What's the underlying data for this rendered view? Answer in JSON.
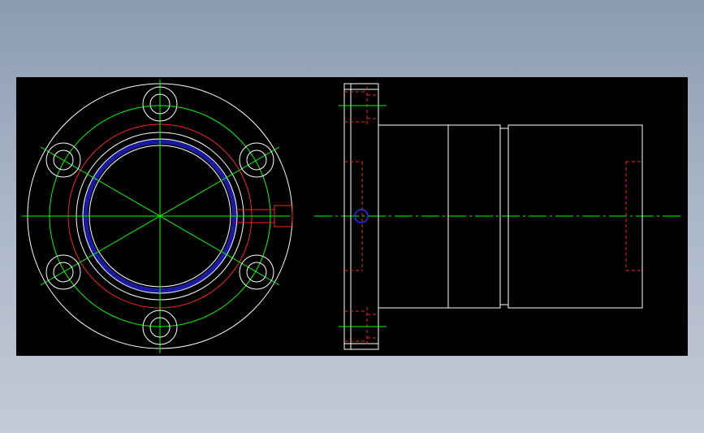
{
  "drawing": {
    "background": "#000000",
    "colors": {
      "outline": "#ffffff",
      "centerline": "#00ff00",
      "hidden": "#ff2020",
      "pitch_circle": "#ff2020",
      "groove": "#1a1aa0",
      "port": "#3030ff"
    },
    "front_view": {
      "bolt_holes": 6,
      "has_lubrication_port": true
    },
    "side_view": {
      "flange": true,
      "body_sections": 3,
      "lubrication_port": true
    }
  }
}
